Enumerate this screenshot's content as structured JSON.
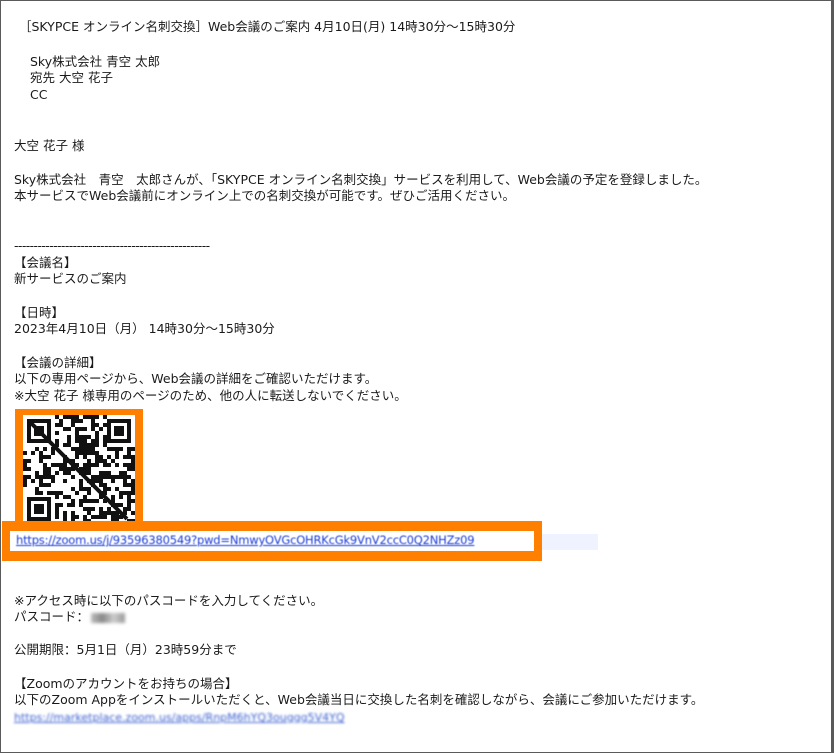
{
  "email": {
    "subject": "［SKYPCE オンライン名刺交換］Web会議のご案内 4月10日(月) 14時30分～15時30分",
    "from": "Sky株式会社 青空 太郎",
    "to": "宛先 大空 花子",
    "cc": "CC",
    "greeting": "大空 花子 様",
    "intro_line1": "Sky株式会社　青空　太郎さんが、「SKYPCE オンライン名刺交換」サービスを利用して、Web会議の予定を登録しました。",
    "intro_line2": "本サービスでWeb会議前にオンライン上での名刺交換が可能です。ぜひご活用ください。",
    "divider": "--------------------------------------------------",
    "meeting_name_label": "【会議名】",
    "meeting_name": "新サービスのご案内",
    "date_label": "【日時】",
    "date_value": "2023年4月10日（月） 14時30分～15時30分",
    "details_label": "【会議の詳細】",
    "details_line1": "以下の専用ページから、Web会議の詳細をご確認いただけます。",
    "details_line2": "※大空 花子 様専用のページのため、他の人に転送しないでください。",
    "meeting_url": "https://zoom.us/j/93596380549?pwd=NmwyOVGcOHRKcGk9VnV2ccC0Q2NHZz09",
    "access_note": "※アクセス時に以下のパスコードを入力してください。",
    "passcode_label": "パスコード：",
    "expiry": "公開期限：5月1日（月）23時59分まで",
    "zoom_account_label": "【Zoomのアカウントをお持ちの場合】",
    "zoom_account_text": "以下のZoom Appをインストールいただくと、Web会議当日に交換した名刺を確認しながら、会議にご参加いただけます。",
    "zoom_app_url": "https://marketplace.zoom.us/apps/RnpM6hYQ3ouggg5V4YQ"
  },
  "colors": {
    "highlight": "#ff7f00",
    "link": "#1a3cd6"
  }
}
